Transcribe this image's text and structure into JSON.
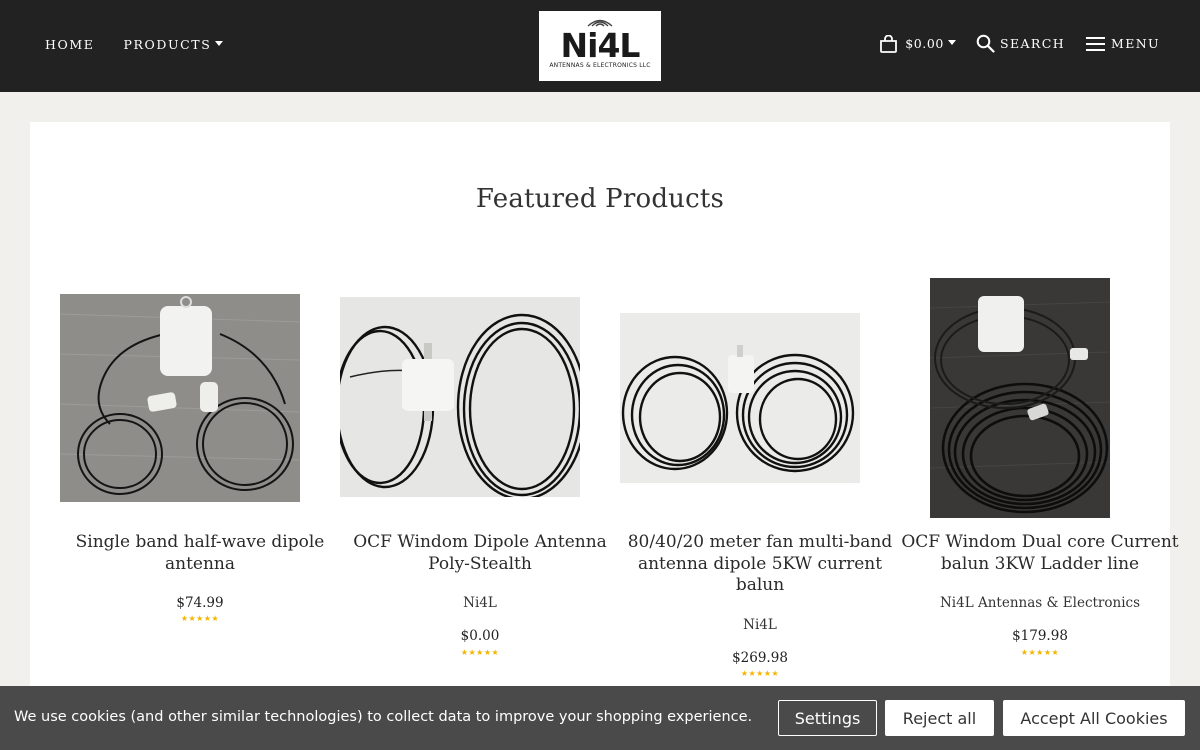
{
  "header": {
    "nav": {
      "home": "HOME",
      "products": "PRODUCTS"
    },
    "logo": {
      "text": "Ni4L",
      "subtitle": "ANTENNAS & ELECTRONICS LLC"
    },
    "cart": {
      "amount": "$0.00"
    },
    "search_label": "SEARCH",
    "menu_label": "MENU"
  },
  "main": {
    "section_title": "Featured Products",
    "products": [
      {
        "title": "Single band half-wave dipole antenna",
        "vendor": "",
        "price": "$74.99",
        "stars": "★★★★★"
      },
      {
        "title": "OCF Windom Dipole Antenna Poly-Stealth",
        "vendor": "Ni4L",
        "price": "$0.00",
        "stars": "★★★★★"
      },
      {
        "title": "80/40/20 meter fan multi-band antenna dipole 5KW current balun",
        "vendor": "Ni4L",
        "price": "$269.98",
        "stars": "★★★★★"
      },
      {
        "title": "OCF Windom Dual core Current balun 3KW Ladder line",
        "vendor": "Ni4L Antennas & Electronics",
        "price": "$179.98",
        "stars": "★★★★★"
      }
    ]
  },
  "cookie_banner": {
    "text": "We use cookies (and other similar technologies) to collect data to improve your shopping experience.",
    "settings_label": "Settings",
    "reject_label": "Reject all",
    "accept_label": "Accept All Cookies"
  },
  "colors": {
    "header_bg": "#222222",
    "page_bg": "#f2f0ec",
    "cookie_bg": "#4a4a4a",
    "star": "#f4b400"
  },
  "icons": [
    "cart-icon",
    "search-icon",
    "hamburger-icon",
    "caret-down-icon"
  ]
}
